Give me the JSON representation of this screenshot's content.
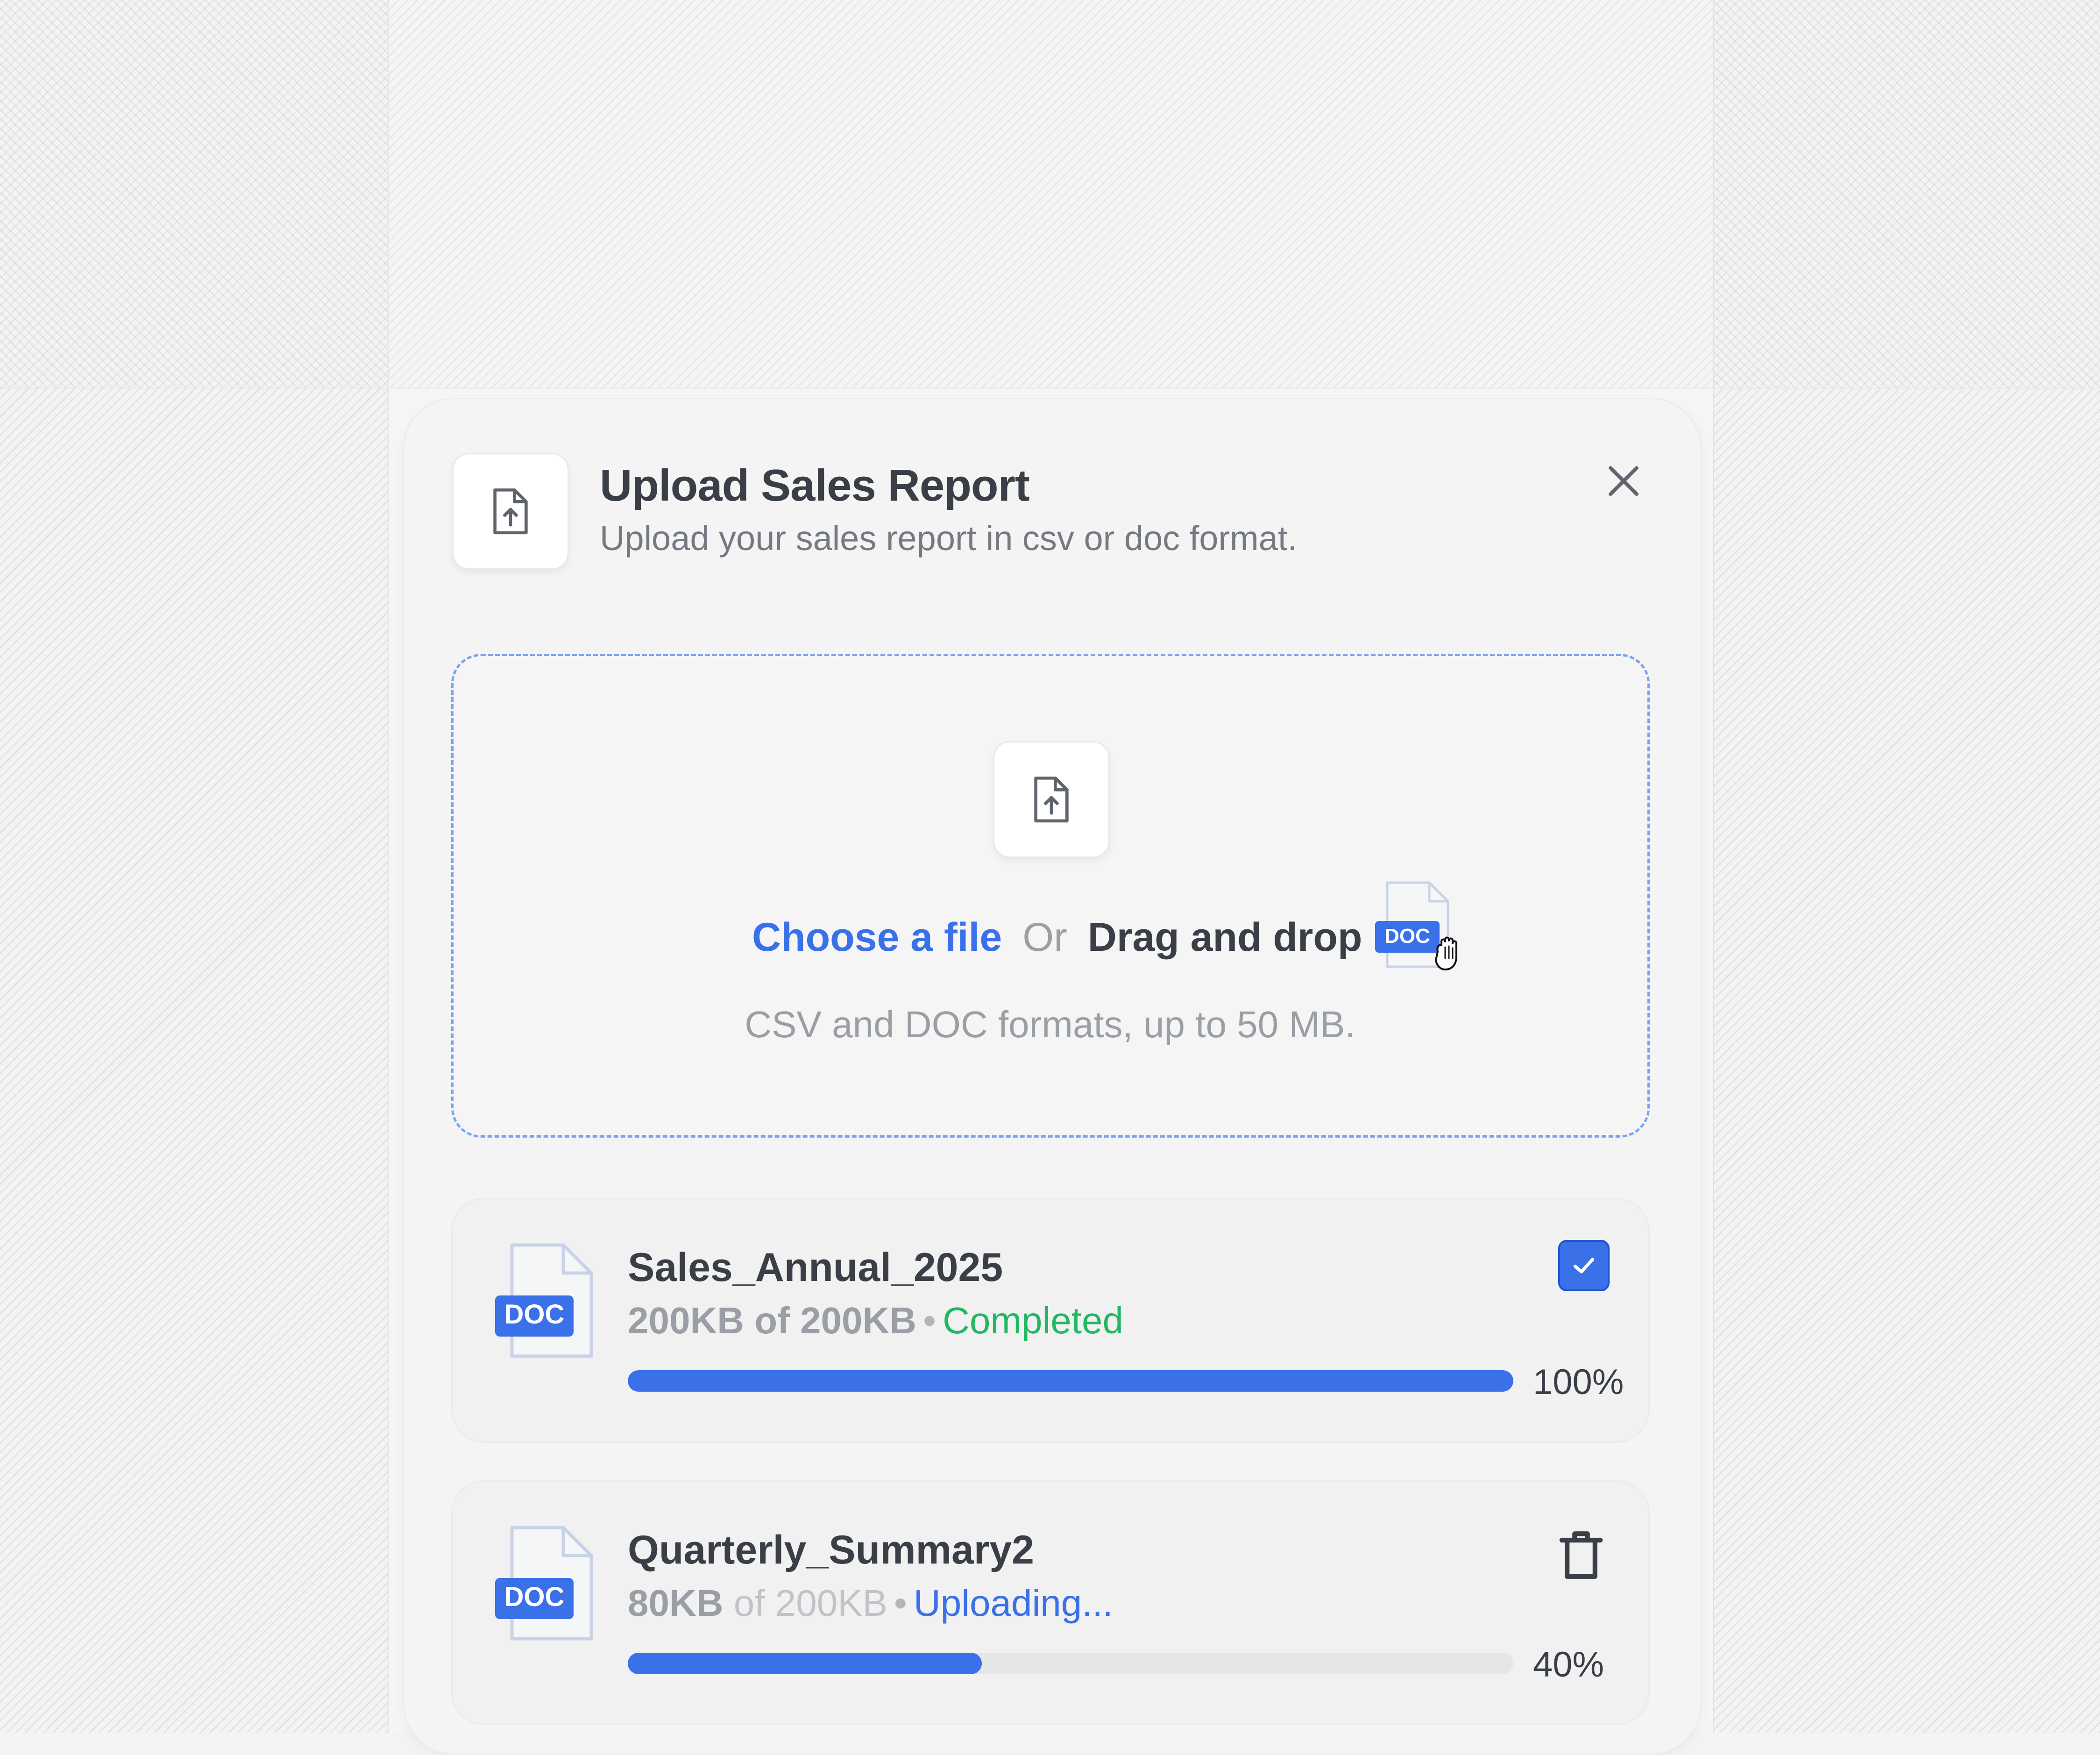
{
  "modal": {
    "title": "Upload Sales Report",
    "subtitle": "Upload your sales report in csv or doc format.",
    "header_icon": "file-upload-icon",
    "close_icon": "close-icon"
  },
  "dropzone": {
    "choose_label": "Choose a file",
    "or_label": "Or",
    "drag_label": "Drag and drop",
    "formats_text": "CSV and DOC  formats, up to 50 MB.",
    "drag_badge": "DOC",
    "icon": "file-upload-icon",
    "cursor_icon": "grab-hand-cursor-icon"
  },
  "files": [
    {
      "badge": "DOC",
      "name": "Sales_Annual_2025",
      "uploaded": "200KB",
      "of_label": "of",
      "total": "200KB",
      "dot": "•",
      "status": "Completed",
      "progress": 1.0,
      "percent_label": "100%",
      "action_icon": "checkbox-checked-icon"
    },
    {
      "badge": "DOC",
      "name": "Quarterly_Summary2",
      "uploaded": "80KB",
      "of_label": "of",
      "total": "200KB",
      "dot": "•",
      "status": "Uploading...",
      "progress": 0.4,
      "percent_label": "40%",
      "action_icon": "trash-icon"
    }
  ],
  "colors": {
    "accent": "#3a70e8",
    "success": "#21b861",
    "text_dark": "#3a3f47",
    "text_muted": "#9a9ea5",
    "dropzone_border": "#7aa3ee"
  }
}
